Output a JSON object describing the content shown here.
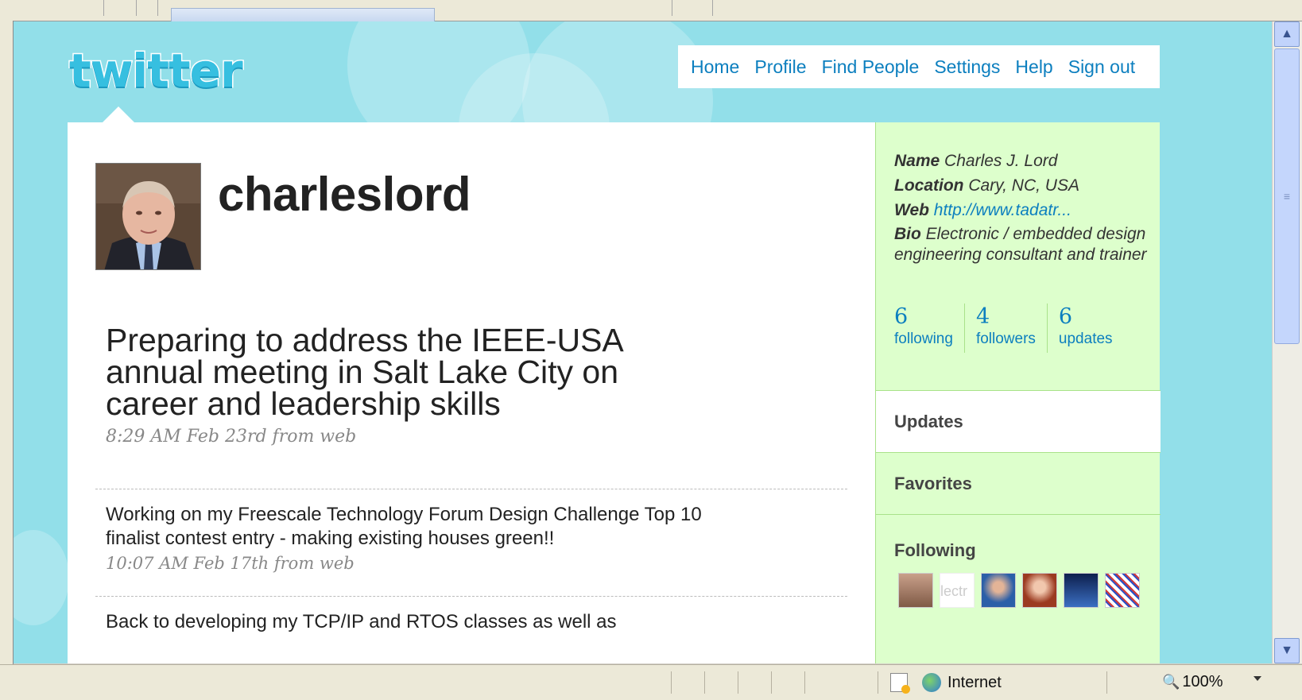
{
  "nav": {
    "items": [
      "Home",
      "Profile",
      "Find People",
      "Settings",
      "Help",
      "Sign out"
    ]
  },
  "logo": {
    "text": "twitter"
  },
  "profile": {
    "username": "charleslord"
  },
  "tweets": [
    {
      "text": "Preparing to address the IEEE-USA annual meeting in Salt Lake City on career and leadership skills",
      "meta": "8:29 AM Feb 23rd from web"
    },
    {
      "text": "Working on my Freescale Technology Forum Design Challenge Top 10 finalist contest entry - making existing houses green!!",
      "meta": "10:07 AM Feb 17th from web"
    },
    {
      "text": "Back to developing my TCP/IP and RTOS classes as well as"
    }
  ],
  "sidebar": {
    "name_label": "Name",
    "name_value": "Charles J. Lord",
    "location_label": "Location",
    "location_value": "Cary, NC, USA",
    "web_label": "Web",
    "web_value": "http://www.tadatr...",
    "bio_label": "Bio",
    "bio_value": "Electronic / embedded design engineering consultant and trainer",
    "stats": [
      {
        "num": "6",
        "label": "following"
      },
      {
        "num": "4",
        "label": "followers"
      },
      {
        "num": "6",
        "label": "updates"
      }
    ],
    "sections": {
      "updates": "Updates",
      "favorites": "Favorites",
      "following": "Following"
    },
    "following_thumb_text": "lectr"
  },
  "statusbar": {
    "zone": "Internet",
    "zoom": "100%"
  },
  "colors": {
    "background": "#92dfe9",
    "link": "#0c7fbf",
    "sidebar": "#ddffcc",
    "sidebar_border": "#a9e28a"
  }
}
